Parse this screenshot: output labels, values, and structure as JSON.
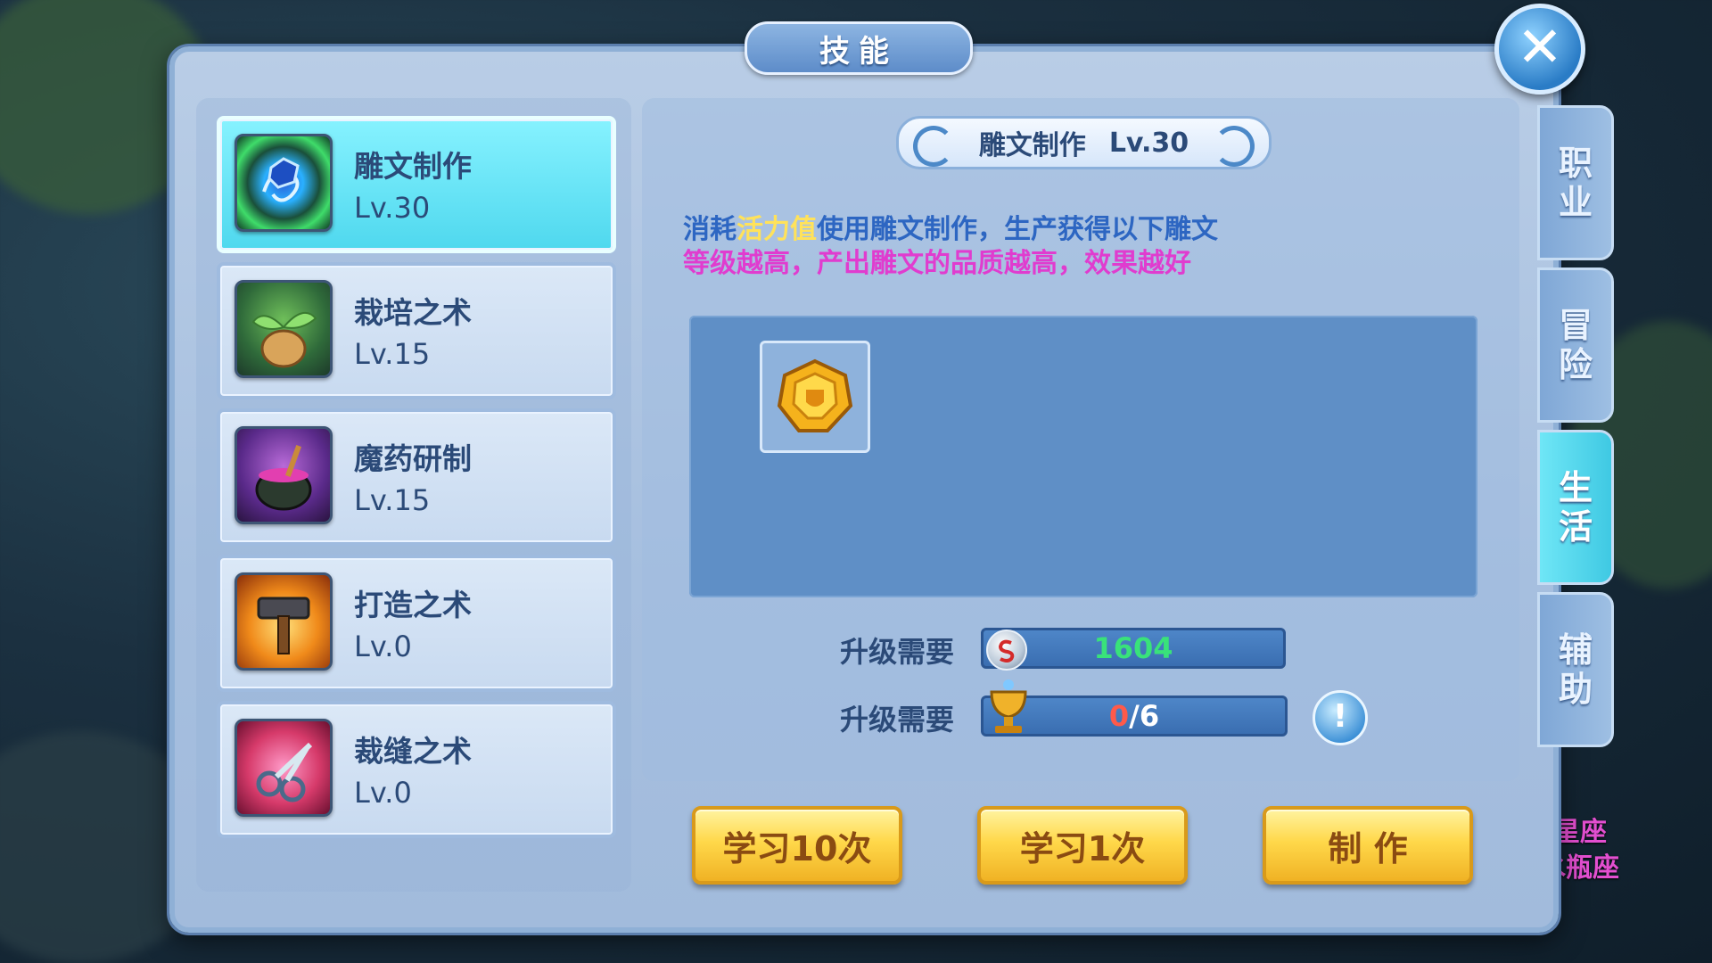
{
  "window": {
    "title": "技能",
    "close_label": "✕"
  },
  "skills": [
    {
      "name": "雕文制作",
      "level": "Lv.30",
      "icon": "rune-swirl-icon",
      "active": true
    },
    {
      "name": "栽培之术",
      "level": "Lv.15",
      "icon": "seed-bag-icon",
      "active": false
    },
    {
      "name": "魔药研制",
      "level": "Lv.15",
      "icon": "potion-cauldron-icon",
      "active": false
    },
    {
      "name": "打造之术",
      "level": "Lv.0",
      "icon": "hammer-icon",
      "active": false
    },
    {
      "name": "裁缝之术",
      "level": "Lv.0",
      "icon": "scissors-icon",
      "active": false
    }
  ],
  "detail": {
    "skill_name": "雕文制作",
    "skill_level": "Lv.30",
    "desc_prefix": "消耗",
    "desc_highlight": "活力值",
    "desc_suffix": "使用雕文制作，生产获得以下雕文",
    "desc_line2": "等级越高，产出雕文的品质越高，效果越好",
    "output_item_icon": "gold-rune-gem-icon"
  },
  "requirements": [
    {
      "label": "升级需要",
      "icon": "silver-coin-icon",
      "value": "1604",
      "value_color": "#39e27a"
    },
    {
      "label": "升级需要",
      "icon": "trophy-icon",
      "current": "0",
      "current_color": "#ff5a4a",
      "slash_total": "/6",
      "total_color": "#ffffff"
    }
  ],
  "buttons": {
    "learn10": "学习10次",
    "learn1": "学习1次",
    "make": "制 作"
  },
  "side_tabs": [
    {
      "label_top": "职",
      "label_bottom": "业",
      "active": false
    },
    {
      "label_top": "冒",
      "label_bottom": "险",
      "active": false
    },
    {
      "label_top": "生",
      "label_bottom": "活",
      "active": true
    },
    {
      "label_top": "辅",
      "label_bottom": "助",
      "active": false
    }
  ],
  "background_text": {
    "line1": "星座",
    "line2": "水瓶座"
  },
  "colors": {
    "accent": "#4fd8ee",
    "gold_button": "#ffd84a",
    "panel": "#a6bfdf"
  }
}
